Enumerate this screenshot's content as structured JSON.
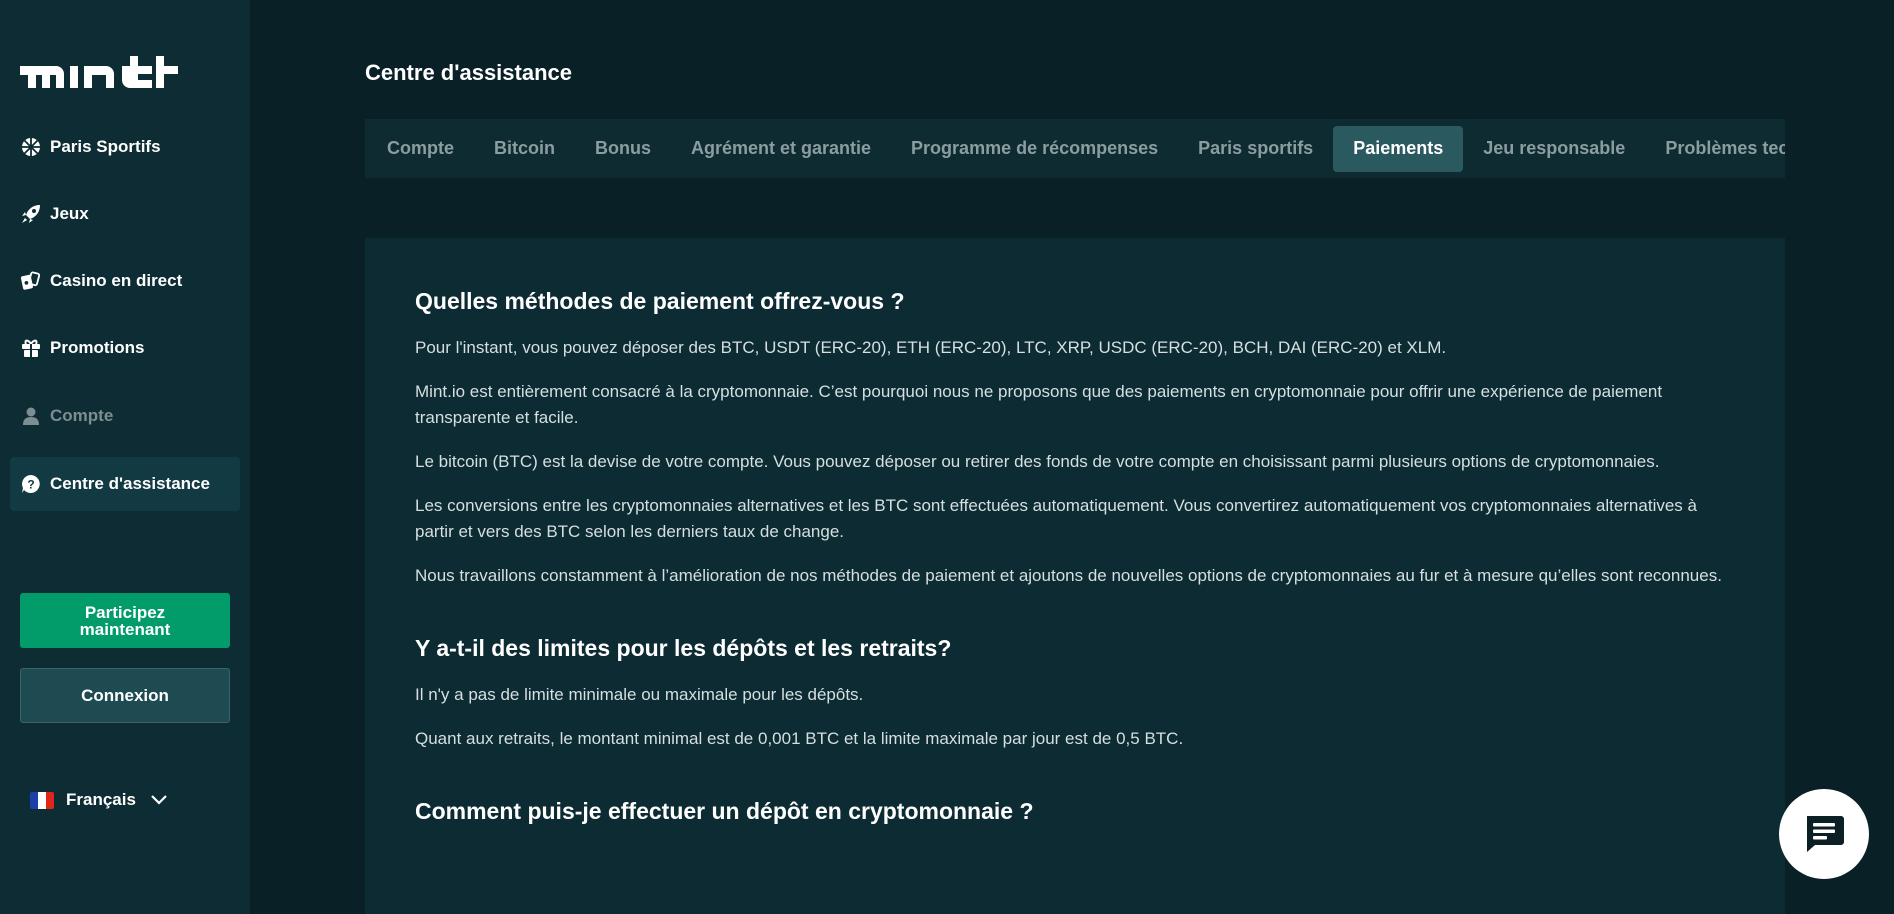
{
  "brand": {
    "logo_text": "mint"
  },
  "sidebar": {
    "items": [
      {
        "label": "Paris Sportifs",
        "icon": "sports-ball-icon"
      },
      {
        "label": "Jeux",
        "icon": "rocket-icon"
      },
      {
        "label": "Casino en direct",
        "icon": "cards-icon"
      },
      {
        "label": "Promotions",
        "icon": "gift-icon"
      },
      {
        "label": "Compte",
        "icon": "user-icon"
      },
      {
        "label": "Centre d'assistance",
        "icon": "help-icon"
      }
    ],
    "join_label": "Participez maintenant",
    "login_label": "Connexion",
    "language": "Français"
  },
  "page": {
    "title": "Centre d'assistance"
  },
  "tabs": [
    "Compte",
    "Bitcoin",
    "Bonus",
    "Agrément et garantie",
    "Programme de récompenses",
    "Paris sportifs",
    "Paiements",
    "Jeu responsable",
    "Problèmes techniques"
  ],
  "active_tab": "Paiements",
  "faq": [
    {
      "question": "Quelles méthodes de paiement offrez-vous ?",
      "paragraphs": [
        "Pour l'instant, vous pouvez déposer des BTC, USDT (ERC-20), ETH (ERC-20), LTC, XRP, USDC (ERC-20), BCH, DAI (ERC-20) et XLM.",
        "Mint.io est entièrement consacré à la cryptomonnaie. C’est pourquoi nous ne proposons que des paiements en cryptomonnaie pour offrir une expérience de paiement transparente et facile.",
        "Le bitcoin (BTC) est la devise de votre compte. Vous pouvez déposer ou retirer des fonds de votre compte en choisissant parmi plusieurs options de cryptomonnaies.",
        "Les conversions entre les cryptomonnaies alternatives et les BTC sont effectuées automatiquement. Vous convertirez automatiquement vos cryptomonnaies alternatives à partir et vers des BTC selon les derniers taux de change.",
        "Nous travaillons constamment à l’amélioration de nos méthodes de paiement et ajoutons de nouvelles options de cryptomonnaies au fur et à mesure qu’elles sont reconnues."
      ]
    },
    {
      "question": "Y a-t-il des limites pour les dépôts et les retraits?",
      "paragraphs": [
        "Il n'y a pas de limite minimale ou maximale pour les dépôts.",
        "Quant aux retraits, le montant minimal est de 0,001 BTC et la limite maximale par jour est de 0,5 BTC."
      ]
    },
    {
      "question": "Comment puis-je effectuer un dépôt en cryptomonnaie ?",
      "paragraphs": []
    }
  ],
  "chat": {
    "icon": "chat-icon"
  },
  "colors": {
    "background": "#082026",
    "sidebar": "#0d2c33",
    "accent_green": "#029b6a",
    "active_tab": "#2a5960"
  }
}
